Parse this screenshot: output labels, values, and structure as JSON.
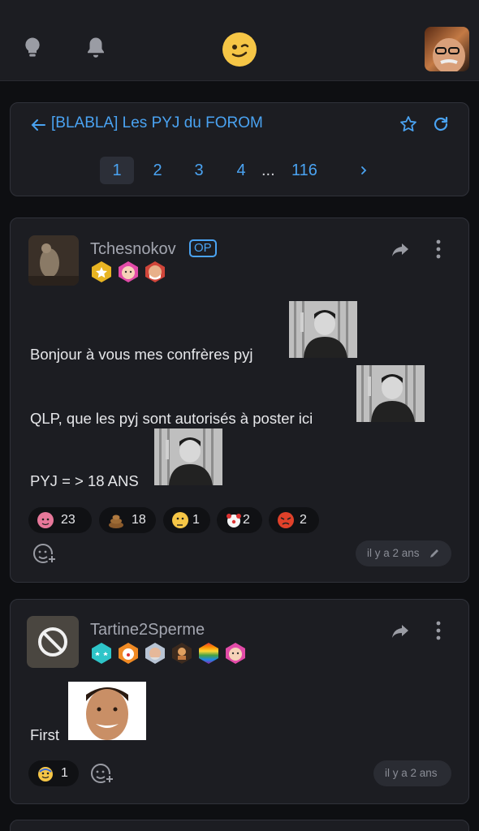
{
  "topbar": {
    "icons": [
      "lightbulb-icon",
      "bell-icon",
      "site-logo-smiley",
      "user-avatar"
    ]
  },
  "topic": {
    "title": "[BLABLA] Les PYJ du FOROM",
    "pages": [
      "1",
      "2",
      "3",
      "4"
    ],
    "ellipsis": "...",
    "last_page": "116",
    "current_page": "1"
  },
  "posts": [
    {
      "username": "Tchesnokov",
      "op_label": "OP",
      "badges": [
        "gold-star-badge",
        "baby-face-badge",
        "bearded-face-badge"
      ],
      "lines": [
        "Bonjour à vous mes confrères pyj",
        "QLP, que les pyj sont autorisés à poster ici",
        "PYJ = > 18 ANS"
      ],
      "reactions": [
        {
          "emoji": "brain-face",
          "count": "23"
        },
        {
          "emoji": "poop",
          "count": "18"
        },
        {
          "emoji": "thinking-face",
          "count": "1"
        },
        {
          "emoji": "clown",
          "count": "2"
        },
        {
          "emoji": "angry-face",
          "count": "2"
        }
      ],
      "timestamp": "il y a 2 ans"
    },
    {
      "username": "Tartine2Sperme",
      "badges": [
        "teal-stars-badge",
        "clown-badge",
        "old-man-badge",
        "chess-badge",
        "rainbow-badge",
        "baby-face-badge"
      ],
      "lines": [
        "First"
      ],
      "reactions": [
        {
          "emoji": "sweat-smile-face",
          "count": "1"
        }
      ],
      "timestamp": "il y a 2 ans"
    }
  ],
  "colors": {
    "accent": "#4aa3f2",
    "card": "#1c1d22",
    "background": "#0e0f12"
  }
}
